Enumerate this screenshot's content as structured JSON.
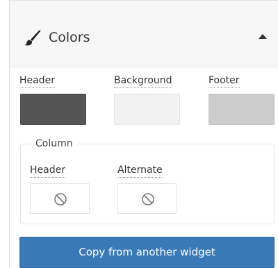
{
  "panel": {
    "title": "Colors",
    "icons": {
      "title": "paint-brush-icon",
      "toggle": "caret-up-icon"
    }
  },
  "colors": {
    "header": {
      "label": "Header",
      "color": "#555555"
    },
    "background": {
      "label": "Background",
      "color": "#f2f2f2"
    },
    "footer": {
      "label": "Footer",
      "color": "#cccccc"
    }
  },
  "column": {
    "legend": "Column",
    "header": {
      "label": "Header",
      "icon": "no-color-icon"
    },
    "alternate": {
      "label": "Alternate",
      "icon": "no-color-icon"
    }
  },
  "actions": {
    "copy_label": "Copy from another widget",
    "button_color": "#3a79b8"
  }
}
